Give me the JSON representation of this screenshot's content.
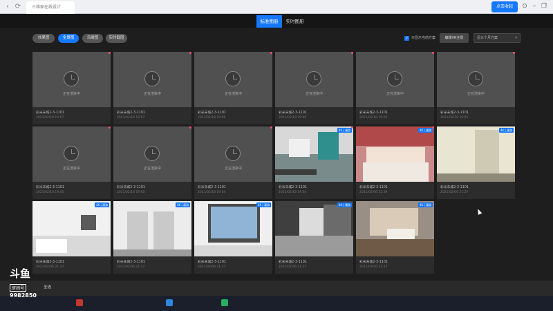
{
  "browser": {
    "tab_title": "三维家在线设计",
    "share_button": "点击收起",
    "nav_icons": [
      "back-icon",
      "refresh-icon"
    ],
    "window_icons": [
      "settings-icon",
      "minimize-icon",
      "restore-icon",
      "close-icon"
    ]
  },
  "modes": [
    {
      "label": "标准图册",
      "active": true
    },
    {
      "label": "实时图册",
      "active": false
    }
  ],
  "filters": [
    {
      "label": "效果图",
      "active": false
    },
    {
      "label": "全景图",
      "active": true
    },
    {
      "label": "鸟瞰图",
      "active": false
    },
    {
      "label": "实时截图",
      "active": false
    }
  ],
  "toolbar": {
    "only_show_label": "只显示当前方案",
    "only_show_checked": true,
    "edit_button": "编辑VR全景",
    "range_select": "近三个月方案"
  },
  "pending_text": "正在渲染中",
  "cards": [
    {
      "title": "彩米未城2-3-1101",
      "date": "2021/02/18 19:07",
      "state": "pending"
    },
    {
      "title": "彩米未城2-3-1101",
      "date": "2021/02/18 19:07",
      "state": "pending"
    },
    {
      "title": "彩米未城2-3-1101",
      "date": "2021/02/18 19:06",
      "state": "pending"
    },
    {
      "title": "彩米未城2-3-1101",
      "date": "2021/02/18 19:06",
      "state": "pending"
    },
    {
      "title": "彩米未城2-3-1101",
      "date": "2021/02/18 19:06",
      "state": "pending"
    },
    {
      "title": "彩米未城2-3-1101",
      "date": "2021/02/18 19:05",
      "state": "pending"
    },
    {
      "title": "彩米未城2-3-1101",
      "date": "2021/02/18 19:05",
      "state": "pending"
    },
    {
      "title": "彩米未城2-3-1101",
      "date": "2021/02/18 19:05",
      "state": "pending"
    },
    {
      "title": "彩米未城2-3-1101",
      "date": "2021/02/18 19:04",
      "state": "pending"
    },
    {
      "title": "彩米未城2-3-1101",
      "date": "2021/02/18 19:04",
      "state": "done",
      "badge": "4K | 漫游",
      "scene": "living"
    },
    {
      "title": "彩米未城2-3-1101",
      "date": "2021/02/06 21:39",
      "state": "done",
      "badge": "4K | 漫游",
      "scene": "bedroom"
    },
    {
      "title": "彩米未城2-3-1101",
      "date": "2021/02/06 21:37",
      "state": "done",
      "badge": "4K | 漫游",
      "scene": "hall"
    },
    {
      "title": "彩米未城2-3-1101",
      "date": "2021/02/06 21:37",
      "state": "done",
      "badge": "4K | 漫游",
      "scene": "bathroom"
    },
    {
      "title": "彩米未城2-3-1101",
      "date": "2021/02/06 21:37",
      "state": "done",
      "badge": "4K | 漫游",
      "scene": "doors"
    },
    {
      "title": "彩米未城2-3-1101",
      "date": "2021/02/06 21:37",
      "state": "done",
      "badge": "4K | 漫游",
      "scene": "window"
    },
    {
      "title": "彩米未城2-3-1101",
      "date": "2021/02/06 21:37",
      "state": "done",
      "badge": "4K | 漫游",
      "scene": "corridor"
    },
    {
      "title": "彩米未城2-3-1101",
      "date": "2021/02/06 21:37",
      "state": "done",
      "badge": "4K | 漫游",
      "scene": "dining"
    }
  ],
  "bottom_bar": {
    "label": "全选"
  },
  "watermark": {
    "logo": "斗鱼",
    "room_label": "房间号",
    "room_number": "9982850"
  },
  "colors": {
    "accent": "#1677ff",
    "status_dot": "#ff4d6d",
    "background": "#1e1e1e"
  }
}
